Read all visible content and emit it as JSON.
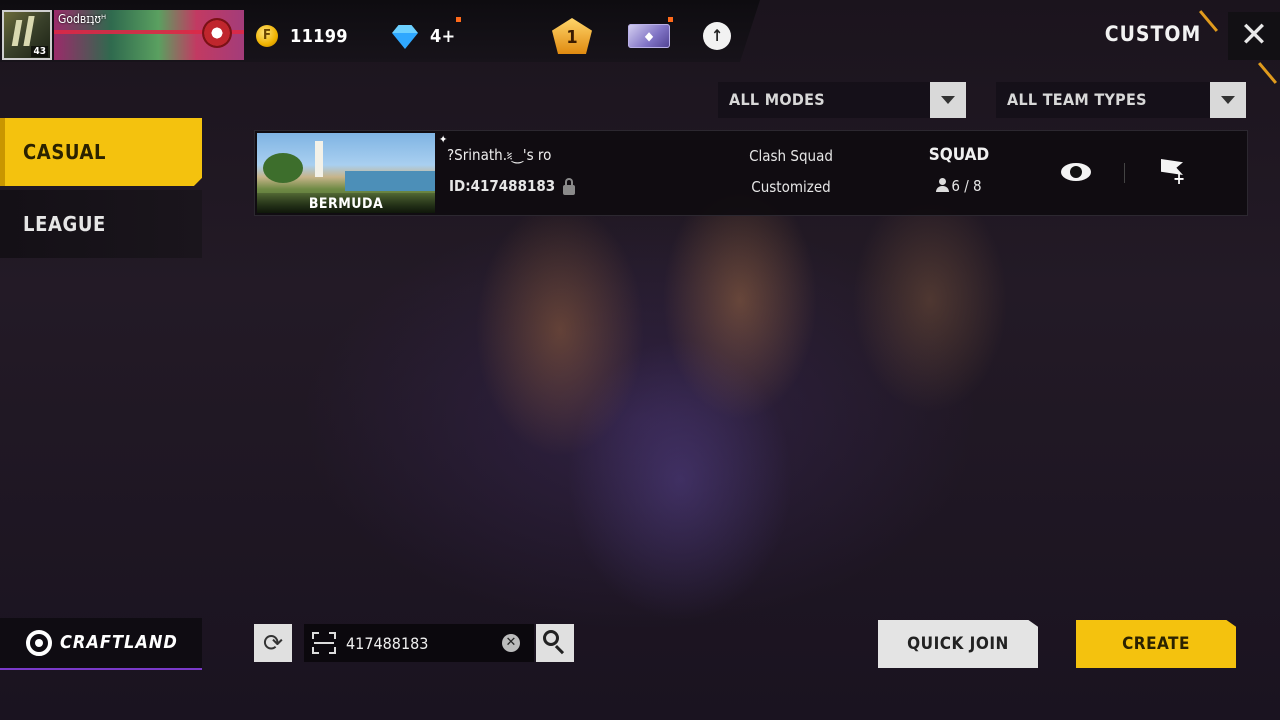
{
  "header": {
    "player_name": "Godʙɪʇʊᴴ",
    "player_level": "43",
    "gold": "11199",
    "diamonds": "4+",
    "rank_number": "1",
    "page_title": "CUSTOM",
    "close_symbol": "✕"
  },
  "filters": {
    "modes": "ALL MODES",
    "team_types": "ALL TEAM TYPES"
  },
  "tabs": [
    {
      "label": "CASUAL",
      "active": true
    },
    {
      "label": "LEAGUE",
      "active": false
    }
  ],
  "rooms": [
    {
      "map": "BERMUDA",
      "owner": "?Srinath.⹏‿'s ro",
      "room_id": "ID:417488183",
      "mode": "Clash Squad",
      "mode_detail": "Customized",
      "team_type": "SQUAD",
      "players": "6 / 8"
    }
  ],
  "bottom": {
    "craftland_label": "CRAFTLAND",
    "search_value": "417488183",
    "quick_join_label": "QUICK JOIN",
    "create_label": "CREATE"
  },
  "colors": {
    "accent_yellow": "#f4c20e",
    "craftland_underline": "#7a3ac9"
  },
  "icons": {
    "gold": "coin-icon",
    "diamond": "diamond-icon",
    "rank": "rank-badge-icon",
    "card": "membership-card-icon",
    "upload": "cloud-upload-icon",
    "close": "close-icon",
    "dropdown": "chevron-down-icon",
    "lock": "lock-icon",
    "players": "person-icon",
    "spectate": "eye-icon",
    "invite": "flag-plus-icon",
    "craftland": "craftland-logo-icon",
    "refresh": "refresh-icon",
    "scan": "scan-icon",
    "clear": "clear-icon",
    "search": "search-icon"
  }
}
